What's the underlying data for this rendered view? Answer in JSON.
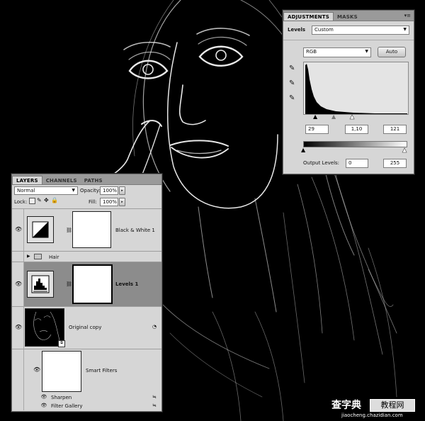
{
  "adjustments_panel": {
    "tabs": [
      "ADJUSTMENTS",
      "MASKS"
    ],
    "preset_label": "Levels",
    "preset_value": "Custom",
    "channel_value": "RGB",
    "auto_label": "Auto",
    "input_black": "29",
    "input_mid": "1,10",
    "input_white": "121",
    "output_label": "Output Levels:",
    "output_black": "0",
    "output_white": "255",
    "histogram_color": "#000000"
  },
  "layers_panel": {
    "tabs": [
      "LAYERS",
      "CHANNELS",
      "PATHS"
    ],
    "blend_mode": "Normal",
    "opacity_label": "Opacity:",
    "opacity_value": "100%",
    "lock_label": "Lock:",
    "fill_label": "Fill:",
    "fill_value": "100%",
    "layers": {
      "bw": "Black & White 1",
      "hair": "Hair",
      "levels": "Levels 1",
      "original": "Original copy",
      "smart_filters": "Smart Filters",
      "sharpen": "Sharpen",
      "filter_gallery": "Filter Gallery"
    },
    "selected_color": "#8c8c8c"
  },
  "watermark": {
    "brand": "查字典",
    "brand_sub": "教程网",
    "url": "jiaocheng.chazidian.com"
  }
}
